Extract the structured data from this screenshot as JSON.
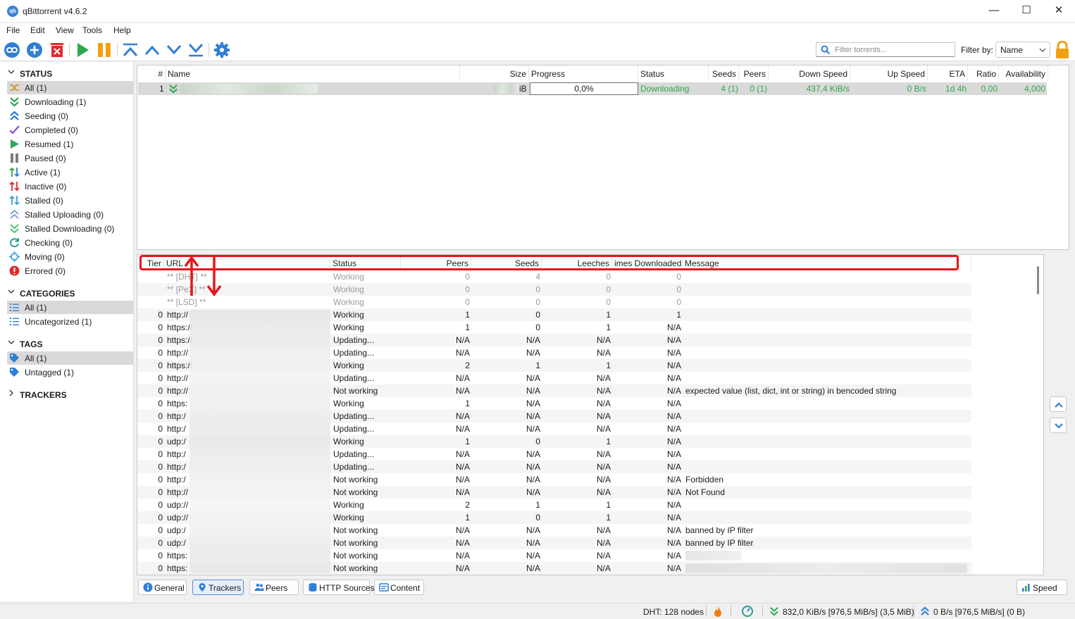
{
  "window": {
    "title": "qBittorrent v4.6.2",
    "minimize": "—",
    "maximize": "☐",
    "close": "✕"
  },
  "menu": [
    "File",
    "Edit",
    "View",
    "Tools",
    "Help"
  ],
  "toolbar": {
    "filter_placeholder": "Filter torrents...",
    "filter_by_label": "Filter by:",
    "filter_by_value": "Name"
  },
  "sidebar": {
    "status_header": "STATUS",
    "status_items": [
      {
        "label": "All (1)",
        "icon": "shuffle-icon",
        "selected": true
      },
      {
        "label": "Downloading (1)",
        "icon": "downloading-icon"
      },
      {
        "label": "Seeding (0)",
        "icon": "seeding-icon"
      },
      {
        "label": "Completed (0)",
        "icon": "check-icon"
      },
      {
        "label": "Resumed (1)",
        "icon": "play-icon"
      },
      {
        "label": "Paused (0)",
        "icon": "pause-icon"
      },
      {
        "label": "Active (1)",
        "icon": "active-arrows-icon"
      },
      {
        "label": "Inactive (0)",
        "icon": "inactive-arrows-icon"
      },
      {
        "label": "Stalled (0)",
        "icon": "stalled-arrows-icon"
      },
      {
        "label": "Stalled Uploading (0)",
        "icon": "stalled-upload-icon"
      },
      {
        "label": "Stalled Downloading (0)",
        "icon": "stalled-download-icon"
      },
      {
        "label": "Checking (0)",
        "icon": "refresh-icon"
      },
      {
        "label": "Moving (0)",
        "icon": "moving-icon"
      },
      {
        "label": "Errored (0)",
        "icon": "error-icon"
      }
    ],
    "categories_header": "CATEGORIES",
    "category_items": [
      {
        "label": "All (1)",
        "selected": true
      },
      {
        "label": "Uncategorized (1)"
      }
    ],
    "tags_header": "TAGS",
    "tag_items": [
      {
        "label": "All (1)",
        "selected": true
      },
      {
        "label": "Untagged (1)"
      }
    ],
    "trackers_header": "TRACKERS"
  },
  "torrent_list": {
    "columns": [
      "#",
      "Name",
      "Size",
      "Progress",
      "Status",
      "Seeds",
      "Peers",
      "Down Speed",
      "Up Speed",
      "ETA",
      "Ratio",
      "Availability"
    ],
    "rows": [
      {
        "num": "1",
        "size_suffix": "iB",
        "progress": "0,0%",
        "status": "Downloading",
        "seeds": "4 (1)",
        "peers": "0 (1)",
        "down_speed": "437,4 KiB/s",
        "up_speed": "0 B/s",
        "eta": "1d 4h",
        "ratio": "0,00",
        "availability": "4,000"
      }
    ]
  },
  "trackers": {
    "columns": [
      "Tier",
      "URL",
      "Status",
      "Peers",
      "Seeds",
      "Leeches",
      "imes Downloaded",
      "Message"
    ],
    "rows": [
      {
        "tier": "",
        "url": "** [DHT] **",
        "status": "Working",
        "peers": "0",
        "seeds": "4",
        "leeches": "0",
        "downloaded": "0",
        "message": "",
        "gray": true
      },
      {
        "tier": "",
        "url": "** [PeX] **",
        "status": "Working",
        "peers": "0",
        "seeds": "0",
        "leeches": "0",
        "downloaded": "0",
        "message": "",
        "gray": true
      },
      {
        "tier": "",
        "url": "** [LSD] **",
        "status": "Working",
        "peers": "0",
        "seeds": "0",
        "leeches": "0",
        "downloaded": "0",
        "message": "",
        "gray": true
      },
      {
        "tier": "0",
        "url": "http://",
        "status": "Working",
        "peers": "1",
        "seeds": "0",
        "leeches": "1",
        "downloaded": "1",
        "message": ""
      },
      {
        "tier": "0",
        "url": "https://",
        "status": "Working",
        "peers": "1",
        "seeds": "0",
        "leeches": "1",
        "downloaded": "N/A",
        "message": ""
      },
      {
        "tier": "0",
        "url": "https://",
        "status": "Updating...",
        "peers": "N/A",
        "seeds": "N/A",
        "leeches": "N/A",
        "downloaded": "N/A",
        "message": ""
      },
      {
        "tier": "0",
        "url": "http://",
        "status": "Updating...",
        "peers": "N/A",
        "seeds": "N/A",
        "leeches": "N/A",
        "downloaded": "N/A",
        "message": ""
      },
      {
        "tier": "0",
        "url": "https://",
        "status": "Working",
        "peers": "2",
        "seeds": "1",
        "leeches": "1",
        "downloaded": "N/A",
        "message": ""
      },
      {
        "tier": "0",
        "url": "http://",
        "status": "Updating...",
        "peers": "N/A",
        "seeds": "N/A",
        "leeches": "N/A",
        "downloaded": "N/A",
        "message": ""
      },
      {
        "tier": "0",
        "url": "http://",
        "status": "Not working",
        "peers": "N/A",
        "seeds": "N/A",
        "leeches": "N/A",
        "downloaded": "N/A",
        "message": "expected value (list, dict, int or string) in bencoded string"
      },
      {
        "tier": "0",
        "url": "https:",
        "status": "Working",
        "peers": "1",
        "seeds": "N/A",
        "leeches": "N/A",
        "downloaded": "N/A",
        "message": ""
      },
      {
        "tier": "0",
        "url": "http:/",
        "status": "Updating...",
        "peers": "N/A",
        "seeds": "N/A",
        "leeches": "N/A",
        "downloaded": "N/A",
        "message": ""
      },
      {
        "tier": "0",
        "url": "http:/",
        "status": "Updating...",
        "peers": "N/A",
        "seeds": "N/A",
        "leeches": "N/A",
        "downloaded": "N/A",
        "message": ""
      },
      {
        "tier": "0",
        "url": "udp:/",
        "status": "Working",
        "peers": "1",
        "seeds": "0",
        "leeches": "1",
        "downloaded": "N/A",
        "message": ""
      },
      {
        "tier": "0",
        "url": "http:/",
        "status": "Updating...",
        "peers": "N/A",
        "seeds": "N/A",
        "leeches": "N/A",
        "downloaded": "N/A",
        "message": ""
      },
      {
        "tier": "0",
        "url": "http:/",
        "status": "Updating...",
        "peers": "N/A",
        "seeds": "N/A",
        "leeches": "N/A",
        "downloaded": "N/A",
        "message": ""
      },
      {
        "tier": "0",
        "url": "http:/",
        "status": "Not working",
        "peers": "N/A",
        "seeds": "N/A",
        "leeches": "N/A",
        "downloaded": "N/A",
        "message": "Forbidden"
      },
      {
        "tier": "0",
        "url": "http://",
        "status": "Not working",
        "peers": "N/A",
        "seeds": "N/A",
        "leeches": "N/A",
        "downloaded": "N/A",
        "message": "Not Found"
      },
      {
        "tier": "0",
        "url": "udp://",
        "status": "Working",
        "peers": "2",
        "seeds": "1",
        "leeches": "1",
        "downloaded": "N/A",
        "message": ""
      },
      {
        "tier": "0",
        "url": "udp://",
        "status": "Working",
        "peers": "1",
        "seeds": "0",
        "leeches": "1",
        "downloaded": "N/A",
        "message": ""
      },
      {
        "tier": "0",
        "url": "udp:/",
        "status": "Not working",
        "peers": "N/A",
        "seeds": "N/A",
        "leeches": "N/A",
        "downloaded": "N/A",
        "message": "banned by IP filter"
      },
      {
        "tier": "0",
        "url": "udp:/",
        "status": "Not working",
        "peers": "N/A",
        "seeds": "N/A",
        "leeches": "N/A",
        "downloaded": "N/A",
        "message": "banned by IP filter"
      },
      {
        "tier": "0",
        "url": "https:",
        "status": "Not working",
        "peers": "N/A",
        "seeds": "N/A",
        "leeches": "N/A",
        "downloaded": "N/A",
        "message": ""
      },
      {
        "tier": "0",
        "url": "https:",
        "status": "Not working",
        "peers": "N/A",
        "seeds": "N/A",
        "leeches": "N/A",
        "downloaded": "N/A",
        "message": ""
      }
    ]
  },
  "bottom_tabs": [
    "General",
    "Trackers",
    "Peers",
    "HTTP Sources",
    "Content"
  ],
  "speed_button": "Speed",
  "statusbar": {
    "dht": "DHT: 128 nodes",
    "download": "832,0 KiB/s [976,5 MiB/s] (3,5 MiB)",
    "upload": "0 B/s [976,5 MiB/s] (0 B)"
  },
  "colors": {
    "accent": "#2f7fd6",
    "green": "#2fa84f",
    "annotation_red": "#e8151b",
    "orange": "#f2a10e"
  }
}
